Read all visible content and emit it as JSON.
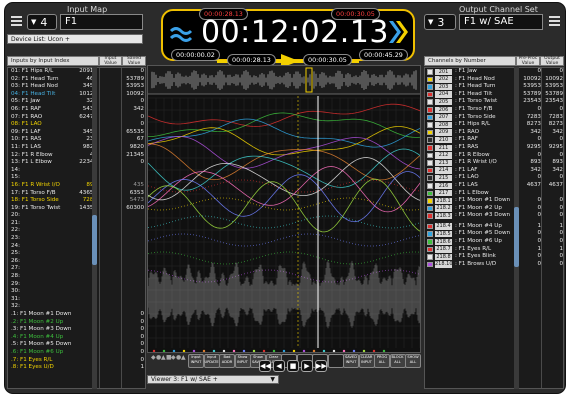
{
  "header": {
    "input_map_title": "Input Map",
    "output_set_title": "Output Channel Set",
    "input_number": "4",
    "input_name": "F1",
    "output_number": "3",
    "output_name": "F1 w/ SAE",
    "device_list": "Device List: Ucon +"
  },
  "timer": {
    "marker_start": "00:00:28.13",
    "marker_end": "00:00:30.05",
    "main_time": "00:12:02.13",
    "elapsed": "00:00:00.02",
    "total": "00:00:45.29",
    "loop_start": "00:00:28.13",
    "loop_end": "00:00:30.05"
  },
  "left_panel": {
    "sort_label": "Inputs by Input Index",
    "col_input": "Input Value",
    "col_saved": "Saved Value",
    "rows": [
      {
        "label": "01: F1 Hips R/L",
        "input": "20917",
        "saved": "0",
        "color": "#e8e8e8"
      },
      {
        "label": "02: F1 Head Turn",
        "input": "468",
        "saved": "53789",
        "color": "#e8e8e8"
      },
      {
        "label": "03: F1 Head Nod",
        "input": "3456",
        "saved": "53953",
        "color": "#e8e8e8"
      },
      {
        "label": "04: F1 Head Tilt",
        "input": "10128",
        "saved": "10092",
        "color": "#46b0e0"
      },
      {
        "label": "05: F1 Jaw",
        "input": "324",
        "saved": "0",
        "color": "#e8e8e8"
      },
      {
        "label": "06: F1 RAF",
        "input": "5436",
        "saved": "342",
        "color": "#e8e8e8"
      },
      {
        "label": "07: F1 RAO",
        "input": "62478",
        "saved": "0",
        "color": "#e8e8e8"
      },
      {
        "label": "08: F1 LAO",
        "input": "",
        "saved": "0",
        "color": "#f2d400"
      },
      {
        "label": "09: F1 LAF",
        "input": "3452",
        "saved": "65535",
        "color": "#e8e8e8"
      },
      {
        "label": "10: F1 RAS",
        "input": "235",
        "saved": "67",
        "color": "#e8e8e8"
      },
      {
        "label": "11: F1 LAS",
        "input": "9820",
        "saved": "9820",
        "color": "#e8e8e8"
      },
      {
        "label": "12: F1 R Elbow",
        "input": "45",
        "saved": "21345",
        "color": "#e8e8e8"
      },
      {
        "label": "13: F1 L Elbow",
        "input": "22345",
        "saved": "0",
        "color": "#e8e8e8"
      },
      {
        "label": "14:",
        "input": "",
        "saved": "",
        "color": "#e8e8e8"
      },
      {
        "label": "15:",
        "input": "",
        "saved": "",
        "color": "#e8e8e8"
      },
      {
        "label": "16: F1 R Wrist I/O",
        "input": "893",
        "saved": "435",
        "color": "#f2d400"
      },
      {
        "label": "17: F1 Torso F/B",
        "input": "43654",
        "saved": "6353",
        "color": "#e8e8e8"
      },
      {
        "label": "18: F1 Torso Side",
        "input": "7283",
        "saved": "5473",
        "color": "#f2d400"
      },
      {
        "label": "19: F1 Torso Twist",
        "input": "14356",
        "saved": "60300",
        "color": "#e8e8e8"
      },
      {
        "label": "20:",
        "input": "",
        "saved": "",
        "color": "#e8e8e8"
      },
      {
        "label": "21:",
        "input": "",
        "saved": "",
        "color": "#e8e8e8"
      },
      {
        "label": "22:",
        "input": "",
        "saved": "",
        "color": "#e8e8e8"
      },
      {
        "label": "23:",
        "input": "",
        "saved": "",
        "color": "#e8e8e8"
      },
      {
        "label": "24:",
        "input": "",
        "saved": "",
        "color": "#e8e8e8"
      },
      {
        "label": "25:",
        "input": "",
        "saved": "",
        "color": "#e8e8e8"
      },
      {
        "label": "26:",
        "input": "",
        "saved": "",
        "color": "#e8e8e8"
      },
      {
        "label": "27:",
        "input": "",
        "saved": "",
        "color": "#e8e8e8"
      },
      {
        "label": "28:",
        "input": "",
        "saved": "",
        "color": "#e8e8e8"
      },
      {
        "label": "29:",
        "input": "",
        "saved": "",
        "color": "#e8e8e8"
      },
      {
        "label": "30:",
        "input": "",
        "saved": "",
        "color": "#e8e8e8"
      },
      {
        "label": "31:",
        "input": "",
        "saved": "",
        "color": "#e8e8e8"
      },
      {
        "label": "32:",
        "input": "",
        "saved": "",
        "color": "#e8e8e8"
      },
      {
        "label": ".1: F1 Moon #1 Down",
        "input": "1",
        "saved": "0",
        "color": "#e8e8e8"
      },
      {
        "label": ".2: F1 Moon #2 Up",
        "input": "0",
        "saved": "0",
        "color": "#3dbf3d"
      },
      {
        "label": ".3: F1 Moon #3 Down",
        "input": "0",
        "saved": "0",
        "color": "#e8e8e8"
      },
      {
        "label": ".4: F1 Moon #4 Up",
        "input": "0",
        "saved": "0",
        "color": "#3dbf3d"
      },
      {
        "label": ".5: F1 Moon #5 Down",
        "input": "0",
        "saved": "0",
        "color": "#e8e8e8"
      },
      {
        "label": ".6: F1 Moon #6 Up",
        "input": "0",
        "saved": "0",
        "color": "#3dbf3d"
      },
      {
        "label": ".7: F1 Eyes R/L",
        "input": "1",
        "saved": "0",
        "color": "#f2d400"
      },
      {
        "label": ".8: F1 Eyes U/D",
        "input": "0",
        "saved": "1",
        "color": "#f2d400"
      }
    ]
  },
  "right_panel": {
    "sort_label": "Channels by Number",
    "col_preproc": "Pre-Proc Value",
    "col_output": "Output Value",
    "rows": [
      {
        "num": "201",
        "label": "F1 Jaw",
        "pre": "0",
        "out": "0",
        "swatch": "#e8e8e8"
      },
      {
        "num": "202",
        "label": "F1 Head Nod",
        "pre": "10092",
        "out": "10092",
        "swatch": "#f2d400"
      },
      {
        "num": "203",
        "label": "F1 Head Turn",
        "pre": "53953",
        "out": "53953",
        "swatch": "#2fa4e0"
      },
      {
        "num": "204",
        "label": "F1 Head Tilt",
        "pre": "53789",
        "out": "53789",
        "swatch": "#e03030"
      },
      {
        "num": "205",
        "label": "F1 Torso Twist",
        "pre": "23543",
        "out": "23543",
        "swatch": "#e8e8e8"
      },
      {
        "num": "206",
        "label": "F1 Torso F/B",
        "pre": "0",
        "out": "0",
        "swatch": "#e03030"
      },
      {
        "num": "207",
        "label": "F1 Torso Side",
        "pre": "7283",
        "out": "7283",
        "swatch": "#2fa4e0"
      },
      {
        "num": "208",
        "label": "F1 Hips R/L",
        "pre": "8273",
        "out": "8273",
        "swatch": "#e8e8e8"
      },
      {
        "num": "209",
        "label": "F1 RAO",
        "pre": "342",
        "out": "342",
        "swatch": "#f2d400"
      },
      {
        "num": "210",
        "label": "F1 RAF",
        "pre": "0",
        "out": "0",
        "swatch": "#2a2a2a"
      },
      {
        "num": "211",
        "label": "F1 RAS",
        "pre": "9295",
        "out": "9295",
        "swatch": "#e03030"
      },
      {
        "num": "212",
        "label": "F1 R Elbow",
        "pre": "0",
        "out": "0",
        "swatch": "#e8e8e8"
      },
      {
        "num": "213",
        "label": "F1 R Wrist I/O",
        "pre": "893",
        "out": "893",
        "swatch": "#e8e8e8"
      },
      {
        "num": "214",
        "label": "F1 LAF",
        "pre": "342",
        "out": "342",
        "swatch": "#e03030"
      },
      {
        "num": "215",
        "label": "F1 LAO",
        "pre": "0",
        "out": "0",
        "swatch": "#2a2a2a"
      },
      {
        "num": "216",
        "label": "F1 LAS",
        "pre": "4637",
        "out": "4637",
        "swatch": "#e8e8e8"
      },
      {
        "num": "217",
        "label": "F1 L Elbow",
        "pre": "",
        "out": "",
        "swatch": "#3dbf3d"
      },
      {
        "num": "218.1",
        "label": "F1 Moon #1 Down",
        "pre": "0",
        "out": "0",
        "swatch": "#f2d400"
      },
      {
        "num": "218.2",
        "label": "F1 Moon #2 Up",
        "pre": "0",
        "out": "0",
        "swatch": "#2fa4e0"
      },
      {
        "num": "218.3",
        "label": "F1 Moon #3 Down",
        "pre": "0",
        "out": "0",
        "swatch": "#e03030"
      },
      {
        "num": "",
        "label": "",
        "pre": "",
        "out": "",
        "swatch": ""
      },
      {
        "num": "218.4",
        "label": "F1 Moon #4 Up",
        "pre": "1",
        "out": "1",
        "swatch": "#e03030"
      },
      {
        "num": "218.5",
        "label": "F1 Moon #5 Down",
        "pre": "0",
        "out": "0",
        "swatch": "#2fa4e0"
      },
      {
        "num": "218.6",
        "label": "F1 Moon #6 Up",
        "pre": "0",
        "out": "0",
        "swatch": "#3dbf3d"
      },
      {
        "num": "218.7",
        "label": "F1 Eyes R/L",
        "pre": "1",
        "out": "1",
        "swatch": "#e03030"
      },
      {
        "num": "218.8",
        "label": "F1 Eyes Blink",
        "pre": "0",
        "out": "0",
        "swatch": "#e8e8e8"
      },
      {
        "num": "218.10",
        "label": "F1 Brows U/D",
        "pre": "0",
        "out": "0",
        "swatch": "#b050e0"
      }
    ]
  },
  "viewer": {
    "label": "Viewer 3: F1 w/ SAE +",
    "ctrl_labels": [
      "Input INPUT",
      "Input UPDATE",
      "Bad ADDR",
      "Show INPUT",
      "Show SAVED",
      "Clear BLOCK",
      "",
      "",
      "",
      "",
      "SAVED INPUT",
      "CLEAR INPUT",
      "PROG ALL",
      "BLOCK ALL",
      "SHOW ALL"
    ],
    "transport": [
      "◀◀",
      "◀",
      "■",
      "▶",
      "▶▶"
    ]
  },
  "colors": {
    "accent_yellow": "#f3d000",
    "timer_red": "#ff4040",
    "panel_bg": "#1b1b1b",
    "app_bg": "#2b2b2b"
  }
}
